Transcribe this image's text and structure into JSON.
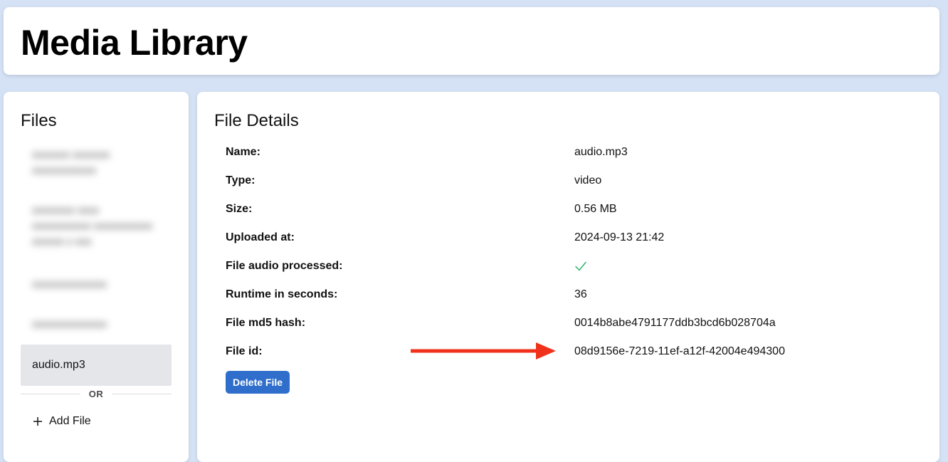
{
  "header": {
    "title": "Media Library"
  },
  "sidebar": {
    "title": "Files",
    "blurred_items": [
      {
        "lines": [
          "xxxxxxx xxxxxxx",
          "xxxxxxxxxxxx"
        ]
      },
      {
        "lines": [
          "xxxxxxxx xxxx",
          "xxxxxxxxxxx xxxxxxxxxxx",
          "xxxxxx x xxx"
        ]
      },
      {
        "lines": [
          "xxxxxxxxxxxxxx"
        ]
      },
      {
        "lines": [
          "xxxxxxxxxxxxxx"
        ]
      }
    ],
    "active_item": "audio.mp3",
    "divider_label": "OR",
    "add_file_label": "Add File"
  },
  "details": {
    "title": "File Details",
    "rows": [
      {
        "label": "Name:",
        "value": "audio.mp3"
      },
      {
        "label": "Type:",
        "value": "video"
      },
      {
        "label": "Size:",
        "value": "0.56 MB"
      },
      {
        "label": "Uploaded at:",
        "value": "2024-09-13 21:42"
      },
      {
        "label": "File audio processed:",
        "value": "",
        "icon": "check-icon"
      },
      {
        "label": "Runtime in seconds:",
        "value": "36"
      },
      {
        "label": "File md5 hash:",
        "value": "0014b8abe4791177ddb3bcd6b028704a"
      },
      {
        "label": "File id:",
        "value": "08d9156e-7219-11ef-a12f-42004e494300"
      }
    ],
    "delete_label": "Delete File"
  },
  "colors": {
    "background": "#d5e2f5",
    "accent_button": "#2f6fcb",
    "check": "#2fb36b",
    "annotation_arrow": "#f0321c",
    "active_item_bg": "#e4e6ea"
  }
}
